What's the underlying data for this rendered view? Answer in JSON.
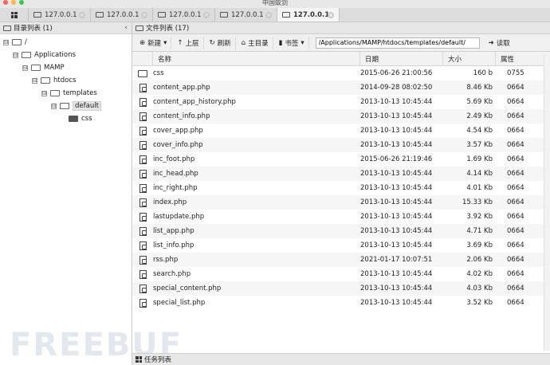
{
  "window": {
    "title": "中国蚁剑"
  },
  "tabs": [
    {
      "label": "127.0.0.1",
      "active": false
    },
    {
      "label": "127.0.0.1",
      "active": false
    },
    {
      "label": "127.0.0.1",
      "active": false
    },
    {
      "label": "127.0.0.1",
      "active": false
    },
    {
      "label": "127.0.0.1",
      "active": true
    }
  ],
  "tab_close_glyph": "×",
  "left_panel": {
    "title": "目录列表 (1)",
    "tree": [
      {
        "label": "/",
        "toggle": "⊟"
      },
      {
        "label": "Applications",
        "toggle": "⊟"
      },
      {
        "label": "MAMP",
        "toggle": "⊟"
      },
      {
        "label": "htdocs",
        "toggle": "⊟"
      },
      {
        "label": "templates",
        "toggle": "⊟"
      },
      {
        "label": "default",
        "toggle": "⊟"
      },
      {
        "label": "css",
        "toggle": ""
      }
    ]
  },
  "right_panel": {
    "title": "文件列表 (17)",
    "toolbar": {
      "new_label": "新建",
      "up_label": "上层",
      "refresh_label": "刷新",
      "home_label": "主目录",
      "bookmark_label": "书签",
      "path_value": "/Applications/MAMP/htdocs/templates/default/",
      "read_label": "读取"
    },
    "columns": {
      "name": "名称",
      "date": "日期",
      "size": "大小",
      "attr": "属性"
    },
    "files": [
      {
        "name": "css",
        "date": "2015-06-26 21:00:56",
        "size": "160 b",
        "attr": "0755",
        "type": "folder"
      },
      {
        "name": "content_app.php",
        "date": "2014-09-28 08:02:50",
        "size": "8.46 Kb",
        "attr": "0664",
        "type": "file"
      },
      {
        "name": "content_app_history.php",
        "date": "2013-10-13 10:45:44",
        "size": "5.69 Kb",
        "attr": "0664",
        "type": "file"
      },
      {
        "name": "content_info.php",
        "date": "2013-10-13 10:45:44",
        "size": "2.49 Kb",
        "attr": "0664",
        "type": "file"
      },
      {
        "name": "cover_app.php",
        "date": "2013-10-13 10:45:44",
        "size": "4.54 Kb",
        "attr": "0664",
        "type": "file"
      },
      {
        "name": "cover_info.php",
        "date": "2013-10-13 10:45:44",
        "size": "3.57 Kb",
        "attr": "0664",
        "type": "file"
      },
      {
        "name": "inc_foot.php",
        "date": "2015-06-26 21:19:46",
        "size": "1.69 Kb",
        "attr": "0664",
        "type": "file"
      },
      {
        "name": "inc_head.php",
        "date": "2013-10-13 10:45:44",
        "size": "4.14 Kb",
        "attr": "0664",
        "type": "file"
      },
      {
        "name": "inc_right.php",
        "date": "2013-10-13 10:45:44",
        "size": "4.01 Kb",
        "attr": "0664",
        "type": "file"
      },
      {
        "name": "index.php",
        "date": "2013-10-13 10:45:44",
        "size": "15.33 Kb",
        "attr": "0664",
        "type": "file"
      },
      {
        "name": "lastupdate.php",
        "date": "2013-10-13 10:45:44",
        "size": "3.92 Kb",
        "attr": "0664",
        "type": "file"
      },
      {
        "name": "list_app.php",
        "date": "2013-10-13 10:45:44",
        "size": "4.71 Kb",
        "attr": "0664",
        "type": "file"
      },
      {
        "name": "list_info.php",
        "date": "2013-10-13 10:45:44",
        "size": "3.69 Kb",
        "attr": "0664",
        "type": "file"
      },
      {
        "name": "rss.php",
        "date": "2021-01-17 10:07:51",
        "size": "2.06 Kb",
        "attr": "0664",
        "type": "file"
      },
      {
        "name": "search.php",
        "date": "2013-10-13 10:45:44",
        "size": "4.02 Kb",
        "attr": "0664",
        "type": "file"
      },
      {
        "name": "special_content.php",
        "date": "2013-10-13 10:45:44",
        "size": "4.03 Kb",
        "attr": "0664",
        "type": "file"
      },
      {
        "name": "special_list.php",
        "date": "2013-10-13 10:45:44",
        "size": "3.52 Kb",
        "attr": "0664",
        "type": "file"
      }
    ]
  },
  "bottom_panel": {
    "title": "任务列表"
  },
  "watermark": "FREEBUF",
  "colors": {
    "close_red": "#fc605c",
    "min_yellow": "#fdbc40",
    "max_green": "#34c84a"
  }
}
